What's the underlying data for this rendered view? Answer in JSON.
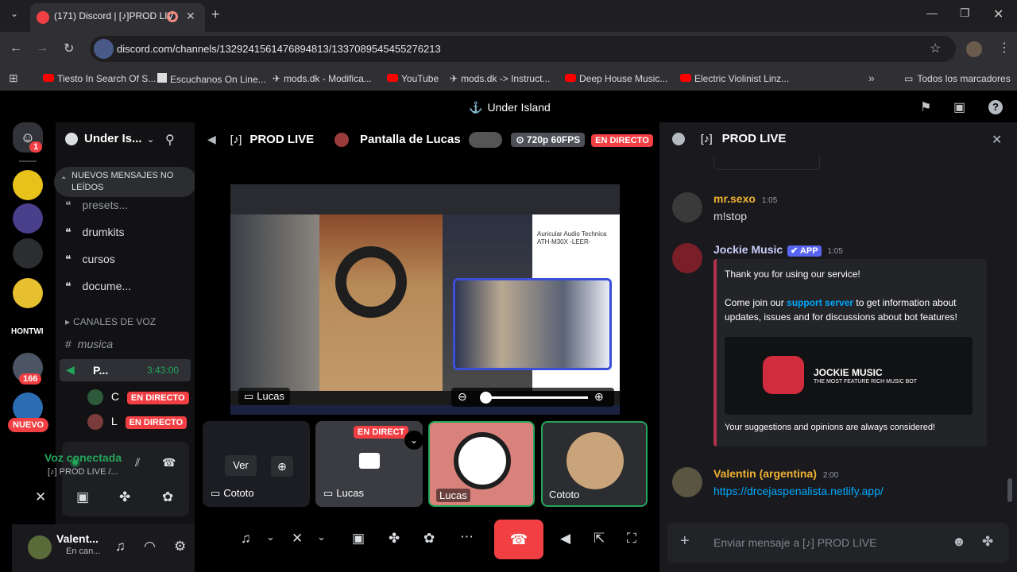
{
  "browser": {
    "tab_title": "(171) Discord | [♪]PROD LIV",
    "url": "discord.com/channels/1329241561476894813/1337089545455276213",
    "bookmarks": [
      "Tiesto In Search Of S...",
      "Escuchanos On Line...",
      "mods.dk - Modifica...",
      "YouTube",
      "mods.dk -> Instruct...",
      "Deep House Music...",
      "Electric Violinist Linz..."
    ],
    "all_bookmarks": "Todos los marcadores"
  },
  "topbar": {
    "server_title": "Under Island"
  },
  "guilds": {
    "mail_badge": "1",
    "badge_166": "166",
    "new_label": "NUEVO",
    "text_icon": "HONTWI"
  },
  "sidebar": {
    "server_name": "Under Is...",
    "new_messages": "NUEVOS MENSAJES NO LEÍDOS",
    "channels": [
      "presets...",
      "drumkits",
      "cursos",
      "docume..."
    ],
    "voice_header": "CANALES DE VOZ",
    "musica": "musica",
    "prod_channel": "P...",
    "timer": "3:43:00",
    "voice_users": [
      {
        "initial": "C",
        "badge": "EN DIRECTO"
      },
      {
        "initial": "L",
        "badge": "EN DIRECTO"
      }
    ],
    "voice_connected": "Voz conectada",
    "voice_channel": "[♪] PROD LIVE /...",
    "user_name": "Valent...",
    "user_status": "En can..."
  },
  "stage": {
    "channel": "PROD LIVE",
    "screen_title": "Pantalla de Lucas",
    "quality": "720p 60FPS",
    "live_badge": "EN DIRECTO",
    "stream_owner": "Lucas",
    "product_title": "Auricular Audio Technica ATH-M30X -LEER-",
    "tiles": [
      {
        "label": "Cototo",
        "button": "Ver"
      },
      {
        "label": "Lucas",
        "badge": "EN DIRECT"
      },
      {
        "label": "Lucas"
      },
      {
        "label": "Cototo"
      }
    ]
  },
  "chat": {
    "title": "PROD LIVE",
    "messages": [
      {
        "author": "mr.sexo",
        "time": "1:05",
        "text": "m!stop",
        "color": "#f0b232"
      },
      {
        "author": "Jockie Music",
        "app": "APP",
        "time": "1:05",
        "color": "#c9cdfb"
      },
      {
        "author": "Valentin (argentina)",
        "time": "2:00",
        "link": "https://drcejaspenalista.netlify.app/",
        "color": "#f0b232"
      }
    ],
    "embed": {
      "line1": "Thank you for using our service!",
      "line2_pre": "Come join our ",
      "line2_link": "support server",
      "line2_post": " to get information about updates, issues and for discussions about bot features!",
      "brand_title": "JOCKIE MUSIC",
      "brand_sub": "THE MOST FEATURE RICH MUSIC BOT",
      "footer": "Your suggestions and opinions are always considered!"
    },
    "input_placeholder": "Enviar mensaje a  [♪] PROD LIVE"
  },
  "colors": {
    "blurple": "#5865f2",
    "red": "#f23f43",
    "green": "#23a55a",
    "link": "#00a8fc"
  }
}
